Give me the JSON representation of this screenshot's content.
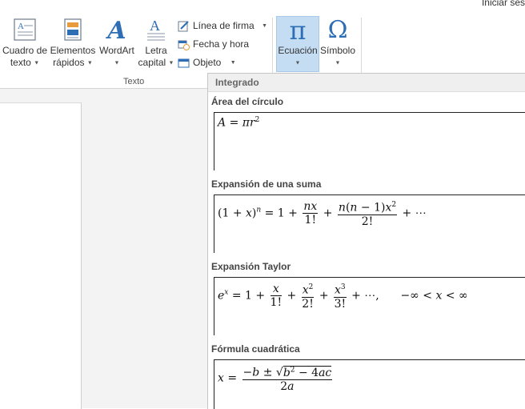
{
  "topbar": {
    "signin_label": "Iniciar ses"
  },
  "ribbon": {
    "buttons": {
      "textbox": {
        "line1": "Cuadro de",
        "line2": "texto"
      },
      "quickparts": {
        "line1": "Elementos",
        "line2": "rápidos"
      },
      "wordart": {
        "line1": "WordArt"
      },
      "dropcap": {
        "line1": "Letra",
        "line2": "capital"
      },
      "signature": {
        "label": "Línea de firma"
      },
      "datetime": {
        "label": "Fecha y hora"
      },
      "object": {
        "label": "Objeto"
      },
      "equation": {
        "line1": "Ecuación"
      },
      "symbol": {
        "line1": "Símbolo"
      }
    },
    "group_text_label": "Texto",
    "icons": {
      "equation_glyph": "π",
      "symbol_glyph": "Ω",
      "wordart_glyph": "A",
      "dropcap_glyph": "A"
    }
  },
  "gallery": {
    "header": "Integrado",
    "sections": [
      {
        "title": "Área del círculo",
        "formula": "A = πr²"
      },
      {
        "title": "Expansión de una suma",
        "formula": "(1 + x)ⁿ = 1 + nx/1! + n(n − 1)x²/2! + ⋯"
      },
      {
        "title": "Expansión Taylor",
        "formula": "eˣ = 1 + x/1! + x²/2! + x³/3! + ⋯,   −∞ < x < ∞"
      },
      {
        "title": "Fórmula cuadrática",
        "formula": "x = (−b ± √(b² − 4ac))/2a"
      }
    ]
  },
  "colors": {
    "accent_blue": "#2b579a",
    "equation_highlight": "#c5ddf3",
    "icon_blue": "#2e6eb5"
  }
}
